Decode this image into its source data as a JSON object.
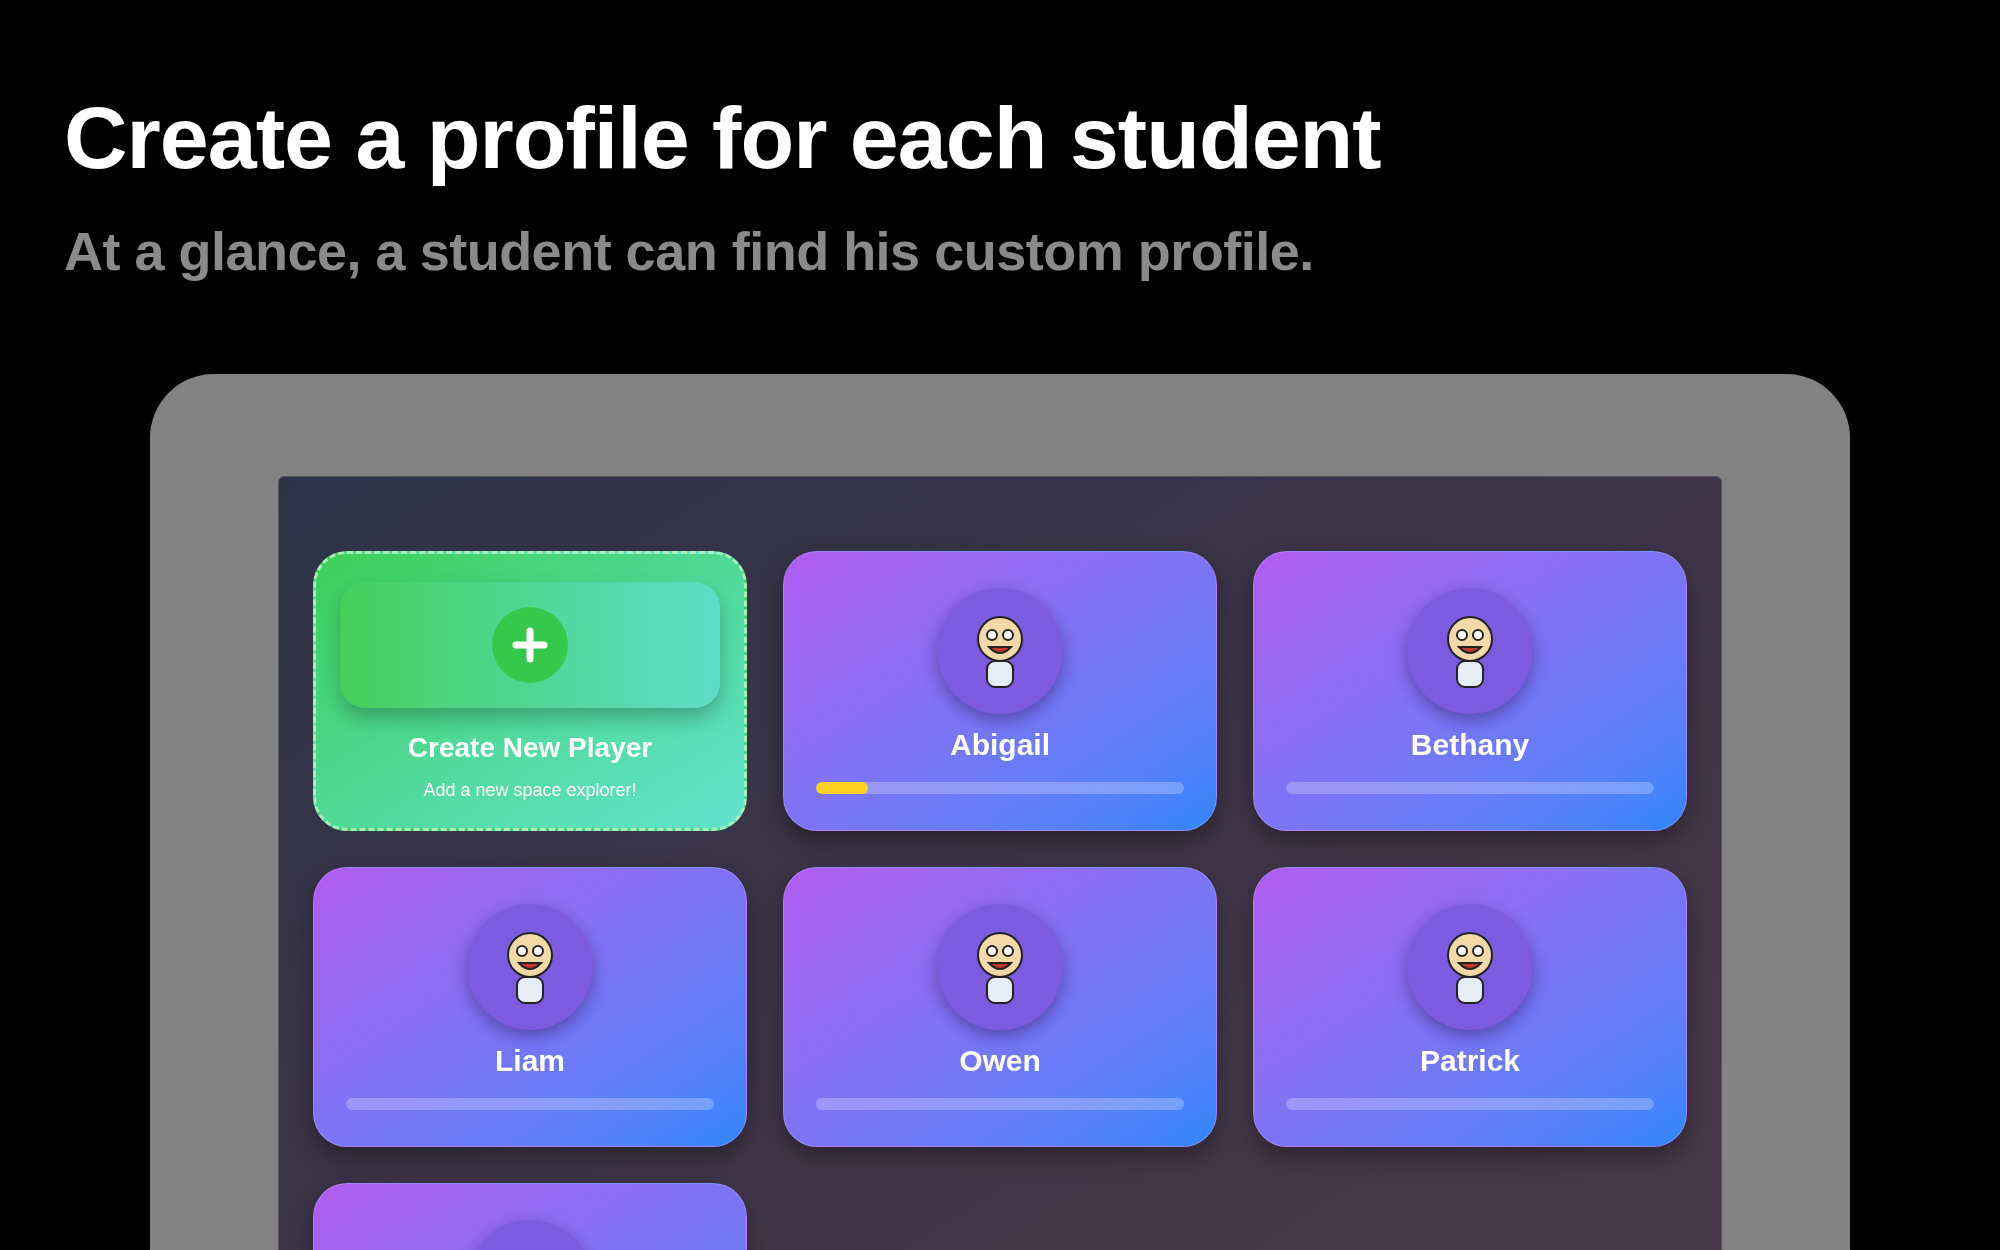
{
  "headline": "Create a profile for each student",
  "subheadline": "At a glance, a student can find his custom profile.",
  "create_card": {
    "title": "Create New Player",
    "subtitle": "Add a new space explorer!"
  },
  "players": [
    {
      "kind": "full",
      "name": "Abigail",
      "level": 0.14
    },
    {
      "kind": "full",
      "name": "Bethany",
      "level": 0
    },
    {
      "kind": "full",
      "name": "Liam",
      "level": 0
    },
    {
      "kind": "full",
      "name": "Owen",
      "level": 0
    },
    {
      "kind": "full",
      "name": "Patrick",
      "level": 0
    },
    {
      "kind": "cut_off"
    }
  ]
}
